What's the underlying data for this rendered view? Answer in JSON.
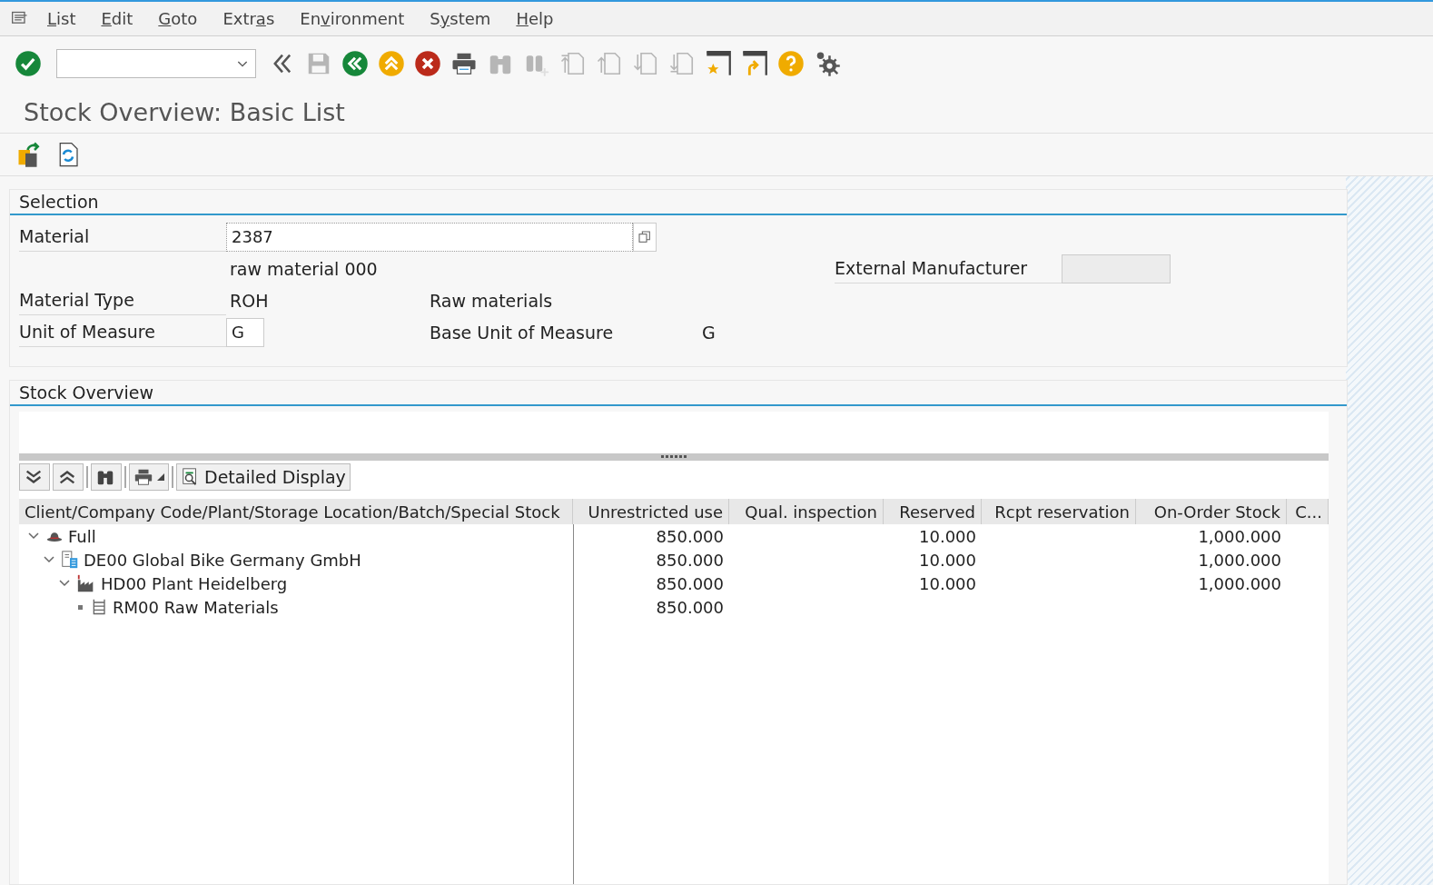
{
  "menu": [
    {
      "key": "L",
      "after": "ist"
    },
    {
      "key": "E",
      "after": "dit"
    },
    {
      "key": "G",
      "after": "oto"
    },
    {
      "before": "Extr",
      "key": "a",
      "after": "s"
    },
    {
      "before": "En",
      "key": "v",
      "after": "ironment"
    },
    {
      "before": "S",
      "key": "y",
      "after": "stem"
    },
    {
      "key": "H",
      "after": "elp"
    }
  ],
  "toolbar": [
    {
      "kind": "enter",
      "disabled": false
    },
    {
      "kind": "command-field",
      "disabled": false
    },
    {
      "kind": "collapse",
      "disabled": false
    },
    {
      "kind": "save",
      "disabled": true
    },
    {
      "kind": "back",
      "disabled": false
    },
    {
      "kind": "exit",
      "disabled": false
    },
    {
      "kind": "cancel",
      "disabled": false
    },
    {
      "kind": "print",
      "disabled": false
    },
    {
      "kind": "find",
      "disabled": true
    },
    {
      "kind": "find-next",
      "disabled": true
    },
    {
      "kind": "first-page",
      "disabled": true
    },
    {
      "kind": "prev-page",
      "disabled": true
    },
    {
      "kind": "next-page",
      "disabled": true
    },
    {
      "kind": "last-page",
      "disabled": true
    },
    {
      "kind": "new-window",
      "disabled": false
    },
    {
      "kind": "shortcut",
      "disabled": false
    },
    {
      "kind": "help",
      "disabled": false
    },
    {
      "kind": "settings",
      "disabled": false
    }
  ],
  "title": "Stock Overview: Basic List",
  "app_toolbar": [
    {
      "kind": "export"
    },
    {
      "kind": "refresh"
    }
  ],
  "selection": {
    "title": "Selection",
    "material": {
      "label": "Material",
      "value": "2387",
      "description": "raw material 000"
    },
    "external_manufacturer": {
      "label": "External Manufacturer",
      "disabled": true
    },
    "material_type": {
      "label": "Material Type",
      "value": "ROH",
      "description": "Raw materials"
    },
    "unit_of_measure": {
      "label": "Unit of Measure",
      "value": "G"
    },
    "base_unit": {
      "label": "Base Unit of Measure",
      "value": "G"
    }
  },
  "stock_overview": {
    "title": "Stock Overview",
    "grid_toolbar": [
      {
        "kind": "expand-all"
      },
      {
        "kind": "collapse-all"
      },
      {
        "kind": "find"
      },
      {
        "kind": "print",
        "dropdown": true
      },
      {
        "kind": "detail",
        "label": "Detailed Display"
      }
    ],
    "columns": [
      "Client/Company Code/Plant/Storage Location/Batch/Special Stock",
      "Unrestricted use",
      "Qual. inspection",
      "Reserved",
      "Rcpt reservation",
      "On-Order Stock",
      "C..."
    ],
    "tree": [
      {
        "kind": "client",
        "label": "Full",
        "expanded": true,
        "unrestricted_use": "850.000",
        "reserved": "10.000",
        "on_order_stock": "1,000.000",
        "children": [
          {
            "kind": "company",
            "label": "DE00 Global Bike Germany GmbH",
            "expanded": true,
            "unrestricted_use": "850.000",
            "reserved": "10.000",
            "on_order_stock": "1,000.000",
            "children": [
              {
                "kind": "plant",
                "label": "HD00 Plant Heidelberg",
                "expanded": true,
                "unrestricted_use": "850.000",
                "reserved": "10.000",
                "on_order_stock": "1,000.000",
                "children": [
                  {
                    "kind": "storage",
                    "label": "RM00 Raw Materials",
                    "unrestricted_use": "850.000"
                  }
                ]
              }
            ]
          }
        ]
      }
    ]
  }
}
